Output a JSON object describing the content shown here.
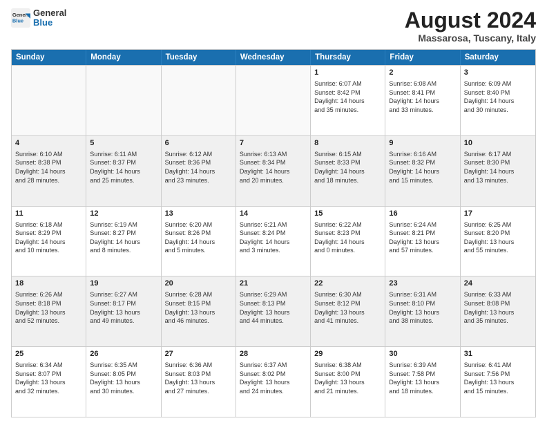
{
  "header": {
    "logo_general": "General",
    "logo_blue": "Blue",
    "month_year": "August 2024",
    "location": "Massarosa, Tuscany, Italy"
  },
  "days_of_week": [
    "Sunday",
    "Monday",
    "Tuesday",
    "Wednesday",
    "Thursday",
    "Friday",
    "Saturday"
  ],
  "weeks": [
    [
      {
        "day": "",
        "info": "",
        "empty": true
      },
      {
        "day": "",
        "info": "",
        "empty": true
      },
      {
        "day": "",
        "info": "",
        "empty": true
      },
      {
        "day": "",
        "info": "",
        "empty": true
      },
      {
        "day": "1",
        "info": "Sunrise: 6:07 AM\nSunset: 8:42 PM\nDaylight: 14 hours\nand 35 minutes."
      },
      {
        "day": "2",
        "info": "Sunrise: 6:08 AM\nSunset: 8:41 PM\nDaylight: 14 hours\nand 33 minutes."
      },
      {
        "day": "3",
        "info": "Sunrise: 6:09 AM\nSunset: 8:40 PM\nDaylight: 14 hours\nand 30 minutes."
      }
    ],
    [
      {
        "day": "4",
        "info": "Sunrise: 6:10 AM\nSunset: 8:38 PM\nDaylight: 14 hours\nand 28 minutes.",
        "shaded": true
      },
      {
        "day": "5",
        "info": "Sunrise: 6:11 AM\nSunset: 8:37 PM\nDaylight: 14 hours\nand 25 minutes.",
        "shaded": true
      },
      {
        "day": "6",
        "info": "Sunrise: 6:12 AM\nSunset: 8:36 PM\nDaylight: 14 hours\nand 23 minutes.",
        "shaded": true
      },
      {
        "day": "7",
        "info": "Sunrise: 6:13 AM\nSunset: 8:34 PM\nDaylight: 14 hours\nand 20 minutes.",
        "shaded": true
      },
      {
        "day": "8",
        "info": "Sunrise: 6:15 AM\nSunset: 8:33 PM\nDaylight: 14 hours\nand 18 minutes.",
        "shaded": true
      },
      {
        "day": "9",
        "info": "Sunrise: 6:16 AM\nSunset: 8:32 PM\nDaylight: 14 hours\nand 15 minutes.",
        "shaded": true
      },
      {
        "day": "10",
        "info": "Sunrise: 6:17 AM\nSunset: 8:30 PM\nDaylight: 14 hours\nand 13 minutes.",
        "shaded": true
      }
    ],
    [
      {
        "day": "11",
        "info": "Sunrise: 6:18 AM\nSunset: 8:29 PM\nDaylight: 14 hours\nand 10 minutes."
      },
      {
        "day": "12",
        "info": "Sunrise: 6:19 AM\nSunset: 8:27 PM\nDaylight: 14 hours\nand 8 minutes."
      },
      {
        "day": "13",
        "info": "Sunrise: 6:20 AM\nSunset: 8:26 PM\nDaylight: 14 hours\nand 5 minutes."
      },
      {
        "day": "14",
        "info": "Sunrise: 6:21 AM\nSunset: 8:24 PM\nDaylight: 14 hours\nand 3 minutes."
      },
      {
        "day": "15",
        "info": "Sunrise: 6:22 AM\nSunset: 8:23 PM\nDaylight: 14 hours\nand 0 minutes."
      },
      {
        "day": "16",
        "info": "Sunrise: 6:24 AM\nSunset: 8:21 PM\nDaylight: 13 hours\nand 57 minutes."
      },
      {
        "day": "17",
        "info": "Sunrise: 6:25 AM\nSunset: 8:20 PM\nDaylight: 13 hours\nand 55 minutes."
      }
    ],
    [
      {
        "day": "18",
        "info": "Sunrise: 6:26 AM\nSunset: 8:18 PM\nDaylight: 13 hours\nand 52 minutes.",
        "shaded": true
      },
      {
        "day": "19",
        "info": "Sunrise: 6:27 AM\nSunset: 8:17 PM\nDaylight: 13 hours\nand 49 minutes.",
        "shaded": true
      },
      {
        "day": "20",
        "info": "Sunrise: 6:28 AM\nSunset: 8:15 PM\nDaylight: 13 hours\nand 46 minutes.",
        "shaded": true
      },
      {
        "day": "21",
        "info": "Sunrise: 6:29 AM\nSunset: 8:13 PM\nDaylight: 13 hours\nand 44 minutes.",
        "shaded": true
      },
      {
        "day": "22",
        "info": "Sunrise: 6:30 AM\nSunset: 8:12 PM\nDaylight: 13 hours\nand 41 minutes.",
        "shaded": true
      },
      {
        "day": "23",
        "info": "Sunrise: 6:31 AM\nSunset: 8:10 PM\nDaylight: 13 hours\nand 38 minutes.",
        "shaded": true
      },
      {
        "day": "24",
        "info": "Sunrise: 6:33 AM\nSunset: 8:08 PM\nDaylight: 13 hours\nand 35 minutes.",
        "shaded": true
      }
    ],
    [
      {
        "day": "25",
        "info": "Sunrise: 6:34 AM\nSunset: 8:07 PM\nDaylight: 13 hours\nand 32 minutes."
      },
      {
        "day": "26",
        "info": "Sunrise: 6:35 AM\nSunset: 8:05 PM\nDaylight: 13 hours\nand 30 minutes."
      },
      {
        "day": "27",
        "info": "Sunrise: 6:36 AM\nSunset: 8:03 PM\nDaylight: 13 hours\nand 27 minutes."
      },
      {
        "day": "28",
        "info": "Sunrise: 6:37 AM\nSunset: 8:02 PM\nDaylight: 13 hours\nand 24 minutes."
      },
      {
        "day": "29",
        "info": "Sunrise: 6:38 AM\nSunset: 8:00 PM\nDaylight: 13 hours\nand 21 minutes."
      },
      {
        "day": "30",
        "info": "Sunrise: 6:39 AM\nSunset: 7:58 PM\nDaylight: 13 hours\nand 18 minutes."
      },
      {
        "day": "31",
        "info": "Sunrise: 6:41 AM\nSunset: 7:56 PM\nDaylight: 13 hours\nand 15 minutes."
      }
    ]
  ]
}
